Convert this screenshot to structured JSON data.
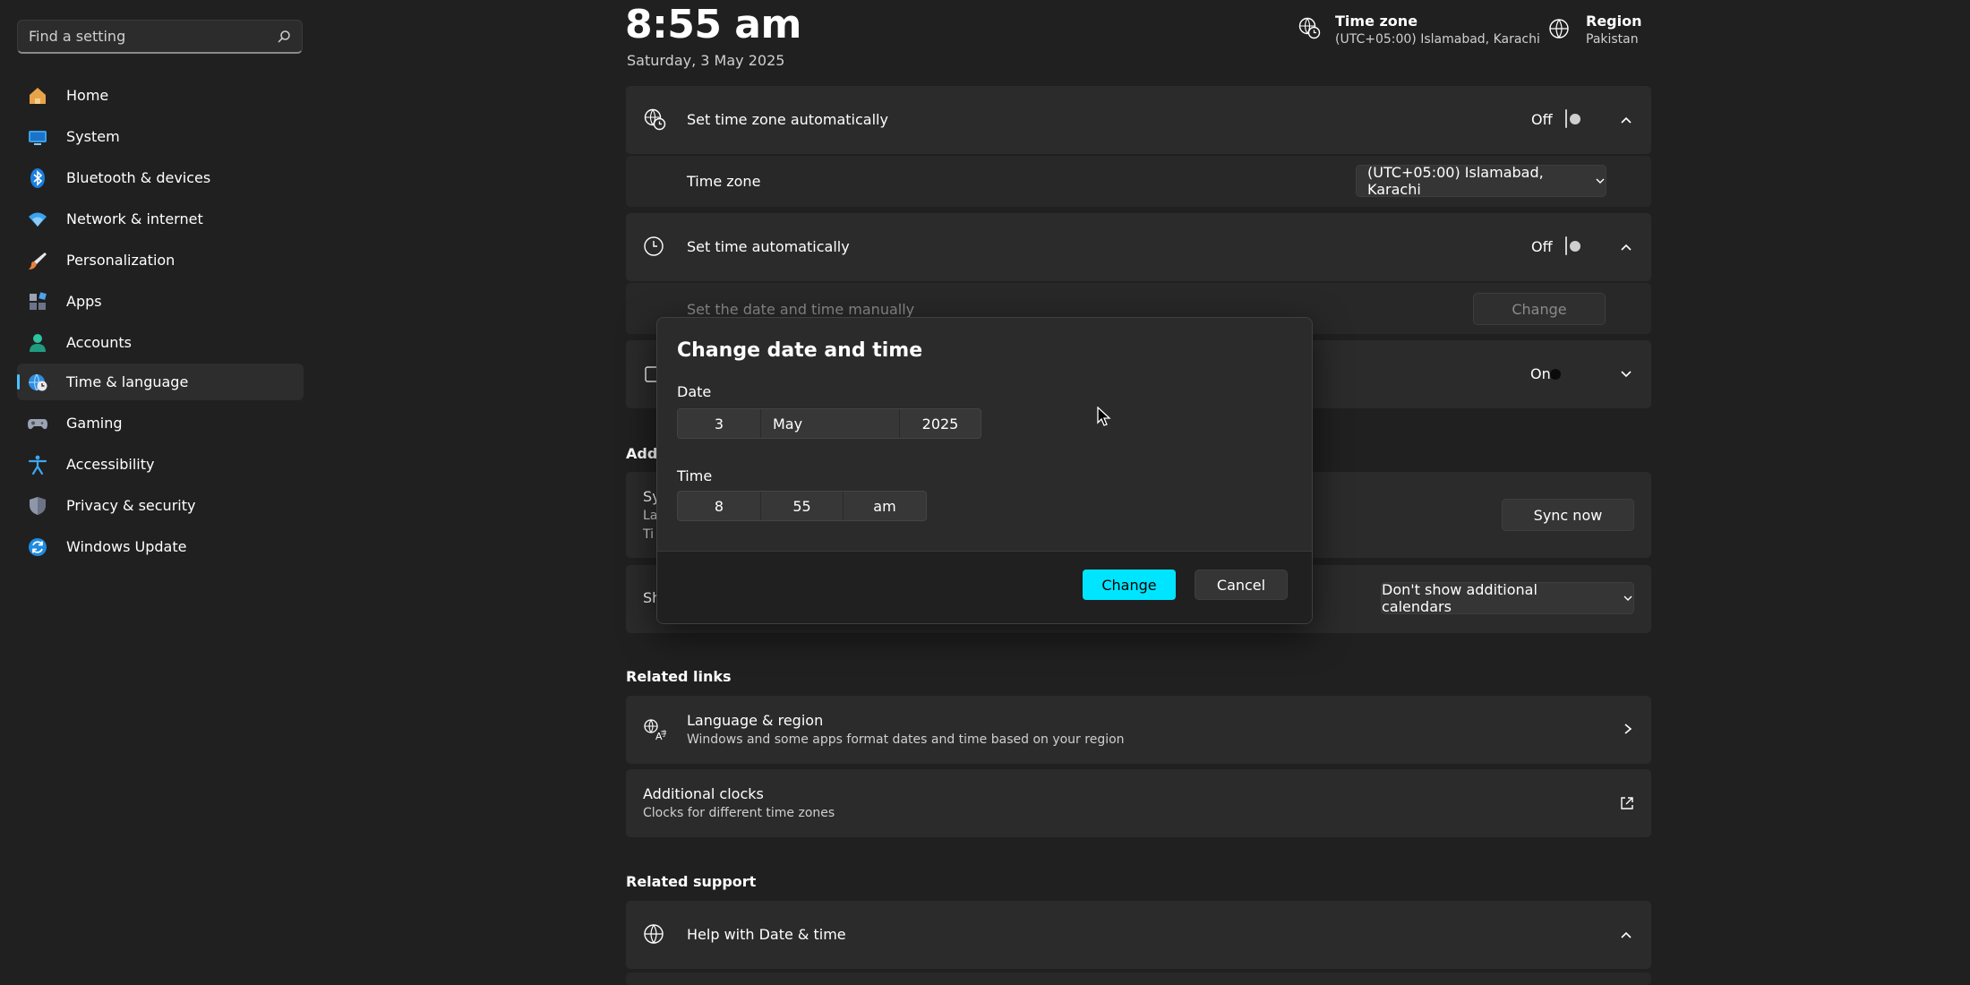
{
  "search": {
    "placeholder": "Find a setting"
  },
  "sidebar": {
    "items": [
      {
        "label": "Home",
        "icon": "home-icon"
      },
      {
        "label": "System",
        "icon": "monitor-icon"
      },
      {
        "label": "Bluetooth & devices",
        "icon": "bluetooth-icon"
      },
      {
        "label": "Network & internet",
        "icon": "wifi-icon"
      },
      {
        "label": "Personalization",
        "icon": "brush-icon"
      },
      {
        "label": "Apps",
        "icon": "apps-icon"
      },
      {
        "label": "Accounts",
        "icon": "person-icon"
      },
      {
        "label": "Time & language",
        "icon": "globe-clock-icon",
        "active": true
      },
      {
        "label": "Gaming",
        "icon": "gamepad-icon"
      },
      {
        "label": "Accessibility",
        "icon": "accessibility-icon"
      },
      {
        "label": "Privacy & security",
        "icon": "shield-icon"
      },
      {
        "label": "Windows Update",
        "icon": "refresh-icon"
      }
    ]
  },
  "header": {
    "time": "8:55 am",
    "date": "Saturday, 3 May 2025",
    "timezone_title": "Time zone",
    "timezone_value": "(UTC+05:00) Islamabad, Karachi",
    "region_title": "Region",
    "region_value": "Pakistan"
  },
  "settings": {
    "auto_timezone": {
      "label": "Set time zone automatically",
      "state": "Off"
    },
    "timezone": {
      "label": "Time zone",
      "value": "(UTC+05:00) Islamabad, Karachi"
    },
    "auto_time": {
      "label": "Set time automatically",
      "state": "Off"
    },
    "manual": {
      "label": "Set the date and time manually",
      "button": "Change"
    },
    "dst": {
      "state": "On"
    },
    "additional_heading_partial": "Addi",
    "sync": {
      "partial_1": "Sy",
      "partial_2": "La",
      "partial_3": "Ti",
      "button": "Sync now"
    },
    "calendar": {
      "partial": "Sh",
      "value": "Don't show additional calendars"
    }
  },
  "related_links": {
    "title": "Related links",
    "language_region": {
      "label": "Language & region",
      "sub": "Windows and some apps format dates and time based on your region"
    },
    "additional_clocks": {
      "label": "Additional clocks",
      "sub": "Clocks for different time zones"
    }
  },
  "related_support": {
    "title": "Related support",
    "help": {
      "label": "Help with Date & time"
    }
  },
  "dialog": {
    "title": "Change date and time",
    "date_label": "Date",
    "day": "3",
    "month": "May",
    "year": "2025",
    "time_label": "Time",
    "hour": "8",
    "minute": "55",
    "ampm": "am",
    "change_button": "Change",
    "cancel_button": "Cancel"
  },
  "colors": {
    "accent": "#00e5ff",
    "background": "#202020",
    "card": "#2b2b2b"
  }
}
